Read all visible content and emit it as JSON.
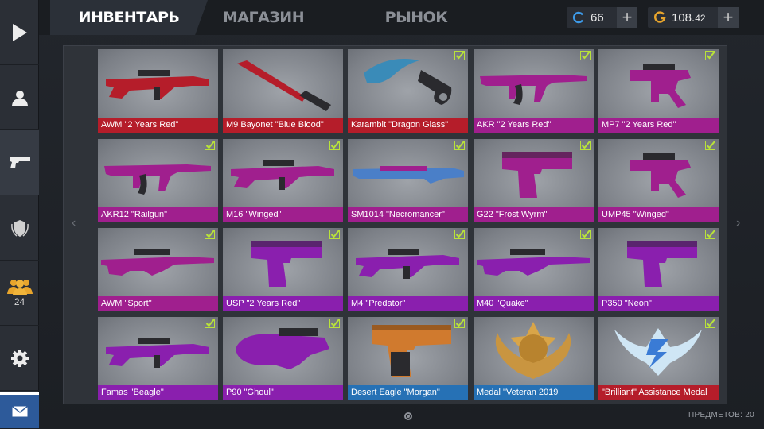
{
  "tabs": [
    {
      "label": "ИНВЕНТАРЬ",
      "active": true
    },
    {
      "label": "МАГАЗИН",
      "active": false
    },
    {
      "label": "РЫНОК",
      "active": false
    }
  ],
  "currency": {
    "credits": {
      "icon": "credits-icon",
      "value": "66"
    },
    "gold": {
      "icon": "gold-icon",
      "value_main": "108.",
      "value_dec": "42"
    }
  },
  "sidebar": {
    "items": [
      {
        "icon": "play-icon"
      },
      {
        "icon": "profile-icon"
      },
      {
        "icon": "pistol-icon",
        "active": true
      },
      {
        "icon": "clan-shield-icon"
      },
      {
        "icon": "friends-icon",
        "count": "24"
      },
      {
        "icon": "gear-icon"
      },
      {
        "icon": "mail-icon"
      }
    ]
  },
  "inventory": {
    "items": [
      {
        "name": "AWM \"2 Years Red\"",
        "rarity": "red",
        "checked": false
      },
      {
        "name": "M9 Bayonet \"Blue Blood\"",
        "rarity": "red",
        "checked": false
      },
      {
        "name": "Karambit \"Dragon Glass\"",
        "rarity": "red",
        "checked": true
      },
      {
        "name": "AKR \"2 Years Red\"",
        "rarity": "magenta",
        "checked": true
      },
      {
        "name": "MP7 \"2 Years Red\"",
        "rarity": "magenta",
        "checked": true
      },
      {
        "name": "AKR12 \"Railgun\"",
        "rarity": "magenta",
        "checked": true
      },
      {
        "name": "M16 \"Winged\"",
        "rarity": "magenta",
        "checked": true
      },
      {
        "name": "SM1014 \"Necromancer\"",
        "rarity": "magenta",
        "checked": true
      },
      {
        "name": "G22 \"Frost Wyrm\"",
        "rarity": "magenta",
        "checked": true
      },
      {
        "name": "UMP45 \"Winged\"",
        "rarity": "magenta",
        "checked": true
      },
      {
        "name": "AWM \"Sport\"",
        "rarity": "magenta",
        "checked": true
      },
      {
        "name": "USP \"2 Years Red\"",
        "rarity": "purple",
        "checked": true
      },
      {
        "name": "M4 \"Predator\"",
        "rarity": "purple",
        "checked": true
      },
      {
        "name": "M40 \"Quake\"",
        "rarity": "purple",
        "checked": true
      },
      {
        "name": "P350 \"Neon\"",
        "rarity": "purple",
        "checked": true
      },
      {
        "name": "Famas \"Beagle\"",
        "rarity": "purple",
        "checked": true
      },
      {
        "name": "P90 \"Ghoul\"",
        "rarity": "purple",
        "checked": true
      },
      {
        "name": "Desert Eagle \"Morgan\"",
        "rarity": "blue",
        "checked": true
      },
      {
        "name": "Medal \"Veteran 2019",
        "rarity": "blue",
        "checked": false
      },
      {
        "name": "\"Brilliant\" Assistance Medal",
        "rarity": "red",
        "checked": true
      }
    ]
  },
  "footer": {
    "items_count": "ПРЕДМЕТОВ: 20"
  },
  "nav": {
    "prev": "‹",
    "next": "›"
  },
  "colors": {
    "red": "#b51d2a",
    "magenta": "#a01f8e",
    "purple": "#8a1fae",
    "blue": "#2671b5",
    "check": "#b9e23a"
  }
}
